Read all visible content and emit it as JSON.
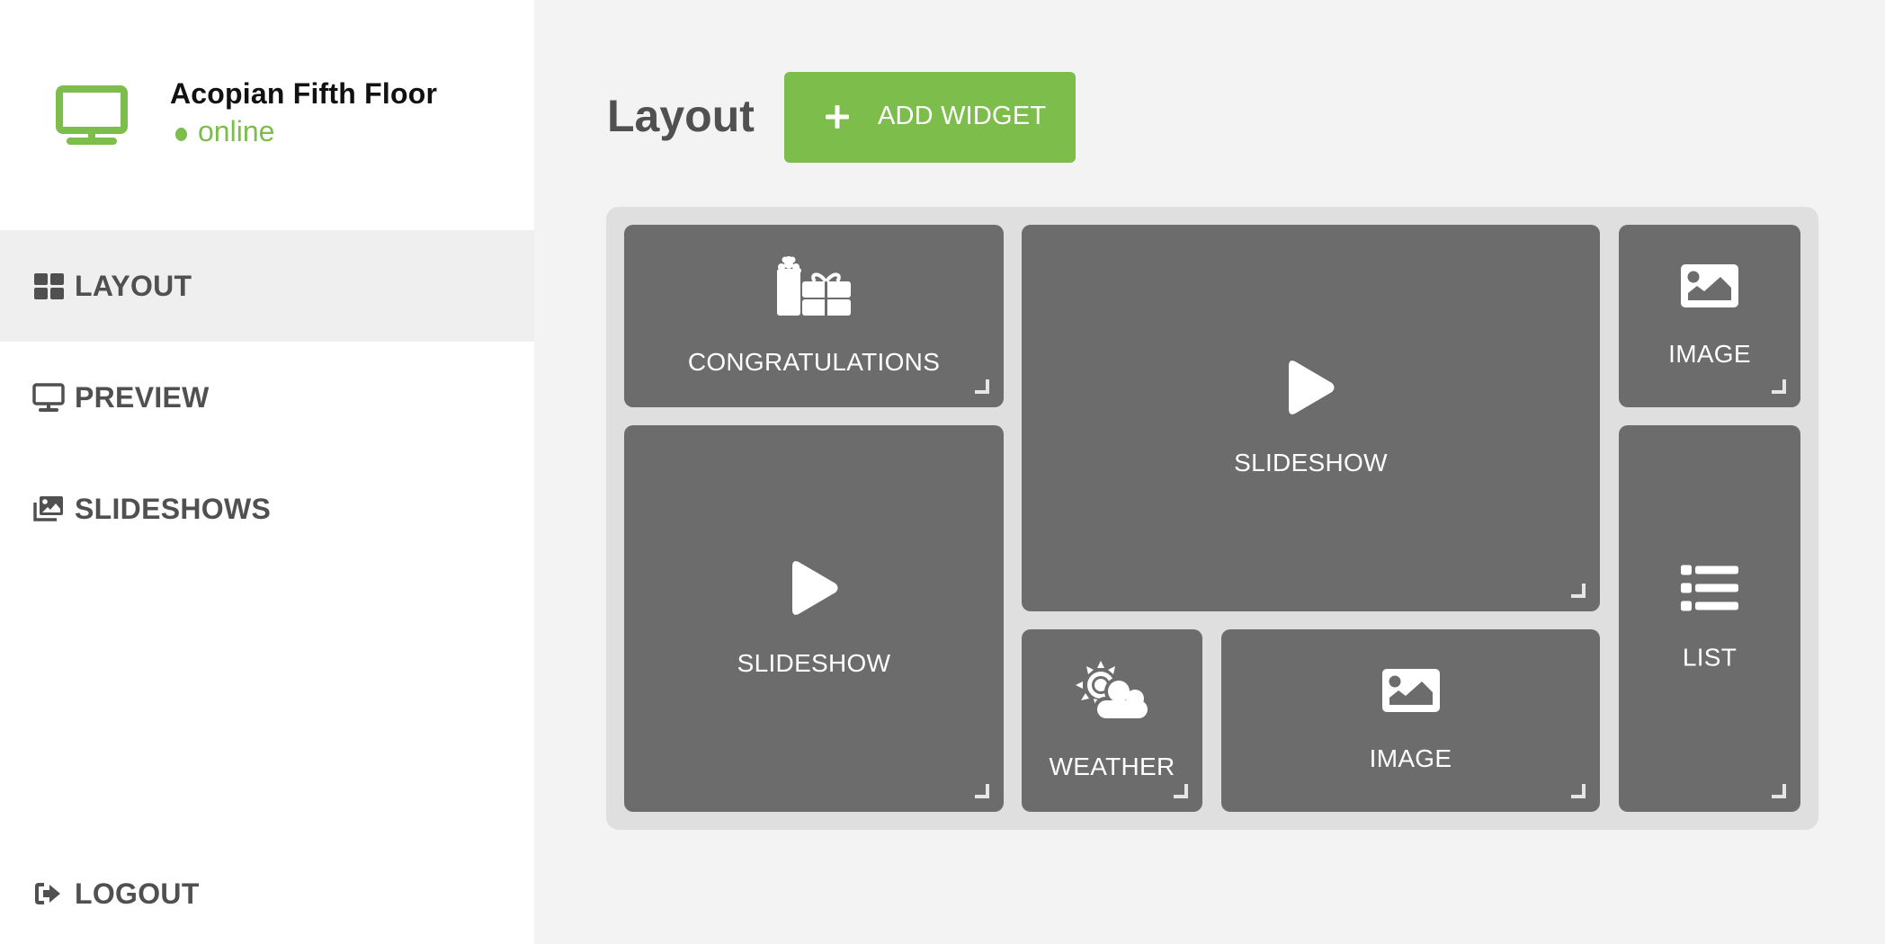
{
  "device": {
    "name": "Acopian Fifth Floor",
    "status": "online",
    "icon": "monitor-icon"
  },
  "colors": {
    "accent": "#7dbd4c",
    "tile": "#6c6c6c",
    "grid_bg": "#dfdfdf",
    "page_bg": "#f3f3f3",
    "sidebar_active": "#efefef",
    "text": "#505050"
  },
  "sidebar": {
    "items": [
      {
        "label": "LAYOUT",
        "icon": "grid-icon",
        "active": true
      },
      {
        "label": "PREVIEW",
        "icon": "monitor-icon",
        "active": false
      },
      {
        "label": "SLIDESHOWS",
        "icon": "images-icon",
        "active": false
      }
    ],
    "logout": {
      "label": "LOGOUT",
      "icon": "sign-out-icon"
    }
  },
  "header": {
    "title": "Layout",
    "add_widget_label": "ADD WIDGET",
    "add_widget_icon": "plus-icon"
  },
  "widgets": [
    {
      "type": "congratulations",
      "label": "CONGRATULATIONS",
      "icon": "gift-icon"
    },
    {
      "type": "slideshow",
      "label": "SLIDESHOW",
      "icon": "play-icon"
    },
    {
      "type": "image",
      "label": "IMAGE",
      "icon": "image-icon"
    },
    {
      "type": "slideshow",
      "label": "SLIDESHOW",
      "icon": "play-icon"
    },
    {
      "type": "weather",
      "label": "WEATHER",
      "icon": "weather-icon"
    },
    {
      "type": "image",
      "label": "IMAGE",
      "icon": "image-icon"
    },
    {
      "type": "list",
      "label": "LIST",
      "icon": "list-icon"
    }
  ]
}
